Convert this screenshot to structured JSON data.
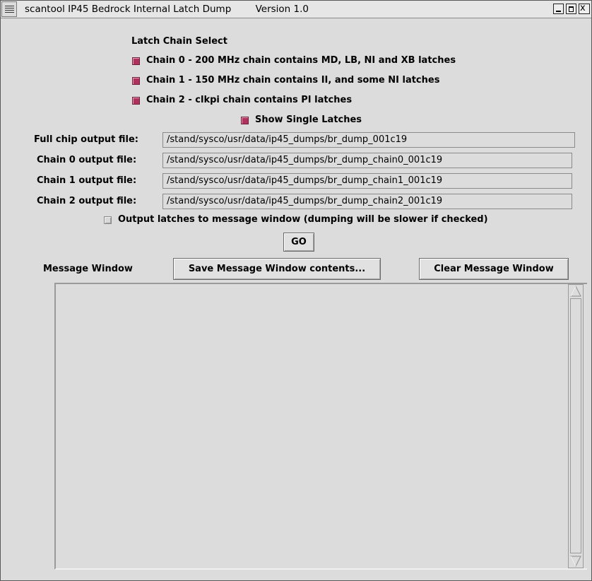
{
  "window": {
    "title": "scantool IP45 Bedrock Internal Latch Dump        Version 1.0",
    "close_glyph": "x"
  },
  "latch_chain": {
    "heading": "Latch Chain Select",
    "chains": [
      {
        "label": "Chain 0 - 200 MHz chain contains MD, LB, NI and XB latches",
        "checked": true
      },
      {
        "label": "Chain 1 - 150 MHz chain contains II, and some NI latches",
        "checked": true
      },
      {
        "label": "Chain 2 - clkpi chain contains PI latches",
        "checked": true
      }
    ],
    "show_single": {
      "label": "Show Single Latches",
      "checked": true
    }
  },
  "files": [
    {
      "label": "Full chip output file:",
      "value": "/stand/sysco/usr/data/ip45_dumps/br_dump_001c19"
    },
    {
      "label": "Chain 0 output file:",
      "value": "/stand/sysco/usr/data/ip45_dumps/br_dump_chain0_001c19"
    },
    {
      "label": "Chain 1 output file:",
      "value": "/stand/sysco/usr/data/ip45_dumps/br_dump_chain1_001c19"
    },
    {
      "label": "Chain 2 output file:",
      "value": "/stand/sysco/usr/data/ip45_dumps/br_dump_chain2_001c19"
    }
  ],
  "output_to_window": {
    "label": "Output latches to message window (dumping will be slower if checked)",
    "checked": false
  },
  "go_label": "GO",
  "message_window": {
    "label": "Message Window",
    "save_label": "Save Message Window contents...",
    "clear_label": "Clear Message Window",
    "content": ""
  },
  "colors": {
    "checked": "#b0305e",
    "background": "#dcdcdc"
  }
}
